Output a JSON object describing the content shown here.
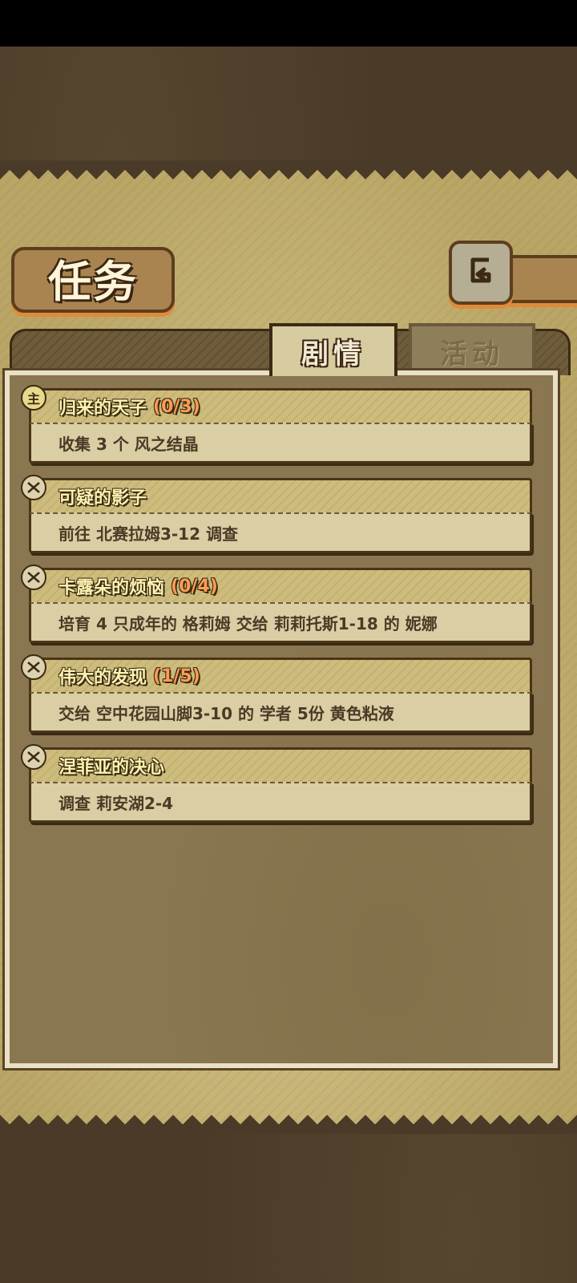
{
  "title": "任务",
  "tabs": [
    {
      "label": "剧情",
      "active": true
    },
    {
      "label": "活动",
      "active": false
    }
  ],
  "quests": [
    {
      "icon": "main-quest-icon",
      "icon_glyph": "主",
      "title": "归来的天子",
      "progress": "(0/3)",
      "objective": "收集 3 个 风之结晶"
    },
    {
      "icon": "side-quest-icon",
      "icon_glyph": "",
      "title": "可疑的影子",
      "progress": "",
      "objective": "前往 北赛拉姆3-12 调查"
    },
    {
      "icon": "side-quest-icon",
      "icon_glyph": "",
      "title": "卡露朵的烦恼",
      "progress": "(0/4)",
      "objective": "培育 4 只成年的 格莉姆 交给 莉莉托斯1-18 的 妮娜"
    },
    {
      "icon": "side-quest-icon",
      "icon_glyph": "",
      "title": "伟大的发现",
      "progress": "(1/5)",
      "objective": "交给 空中花园山脚3-10 的 学者 5份 黄色粘液"
    },
    {
      "icon": "side-quest-icon",
      "icon_glyph": "",
      "title": "涅菲亚的决心",
      "progress": "",
      "objective": "调查 莉安湖2-4"
    }
  ],
  "colors": {
    "progress": "#ff9d53",
    "quest_title": "#fbf3b0",
    "accent_shadow": "#e08a3a"
  }
}
